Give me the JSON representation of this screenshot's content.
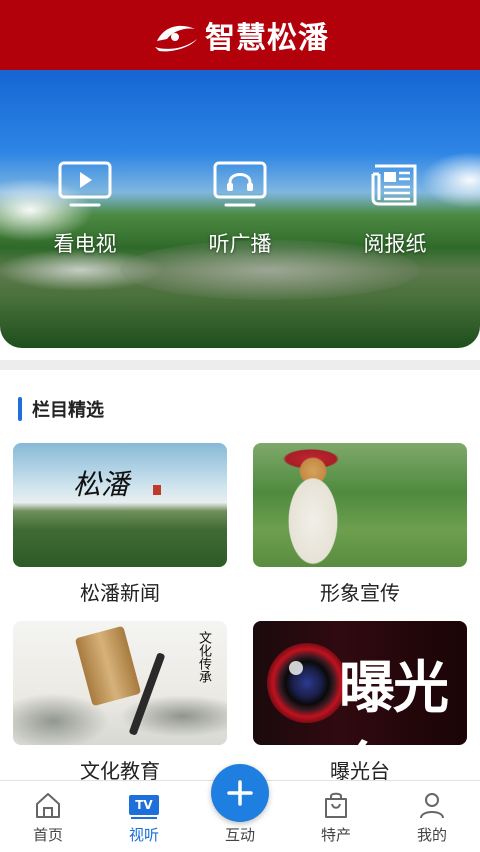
{
  "header": {
    "title": "智慧松潘",
    "logo_icon": "swirl-logo-icon"
  },
  "hero": {
    "items": [
      {
        "label": "看电视",
        "icon": "tv-play-icon"
      },
      {
        "label": "听广播",
        "icon": "radio-headphones-icon"
      },
      {
        "label": "阅报纸",
        "icon": "newspaper-icon"
      }
    ]
  },
  "section": {
    "title": "栏目精选"
  },
  "cards": [
    {
      "label": "松潘新闻",
      "thumb_text": "松潘"
    },
    {
      "label": "形象宣传"
    },
    {
      "label": "文化教育",
      "thumb_text": "文化传承"
    },
    {
      "label": "曝光台",
      "thumb_text": "曝光台"
    }
  ],
  "nav": {
    "items": [
      {
        "label": "首页",
        "icon": "home-icon"
      },
      {
        "label": "视听",
        "icon": "tv-icon",
        "badge": "TV",
        "active": true
      },
      {
        "label": "互动",
        "icon": "plus-icon"
      },
      {
        "label": "特产",
        "icon": "shopping-bag-icon"
      },
      {
        "label": "我的",
        "icon": "user-icon"
      }
    ]
  },
  "colors": {
    "brand_red": "#b3010c",
    "accent_blue": "#1e6fd9"
  }
}
